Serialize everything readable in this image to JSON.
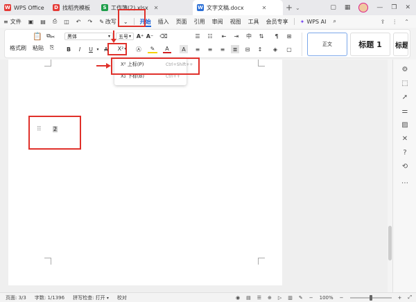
{
  "tabs": [
    {
      "label": "WPS Office",
      "icon": "wps-logo-icon",
      "color": "#e53935"
    },
    {
      "label": "找稻壳模板",
      "icon": "docer-icon",
      "color": "#e53935"
    },
    {
      "label": "工作簿(2).xlsx",
      "icon": "spreadsheet-icon",
      "color": "#1e9e4a"
    },
    {
      "label": "文字文稿.docx",
      "icon": "word-doc-icon",
      "color": "#2b6fd6"
    }
  ],
  "menu": {
    "file": "文件",
    "edit_mode": "改写",
    "items": [
      "开始",
      "插入",
      "页面",
      "引用",
      "审阅",
      "视图",
      "工具",
      "会员专享"
    ],
    "ai": "WPS AI"
  },
  "ribbon": {
    "format_painter": "格式刷",
    "paste": "粘贴",
    "font_name": "黑体",
    "font_size": "五号",
    "superscript": "X²",
    "style_normal": "正文",
    "style_h1": "标题 1",
    "style_h2": "标题"
  },
  "dropdown": {
    "items": [
      {
        "label": "X² 上标(P)",
        "shortcut": "Ctrl+Shift++"
      },
      {
        "label": "X₂ 下标(B)",
        "shortcut": "Ctrl++"
      }
    ]
  },
  "document": {
    "handle": "⠿",
    "text": "2"
  },
  "status": {
    "page": "页面: 3/3",
    "words": "字数: 1/1396",
    "spell": "拼写检查: 打开",
    "proof": "校对",
    "zoom": "100%"
  },
  "colors": {
    "accent": "#1a61d6",
    "annotation": "#e0302a"
  }
}
